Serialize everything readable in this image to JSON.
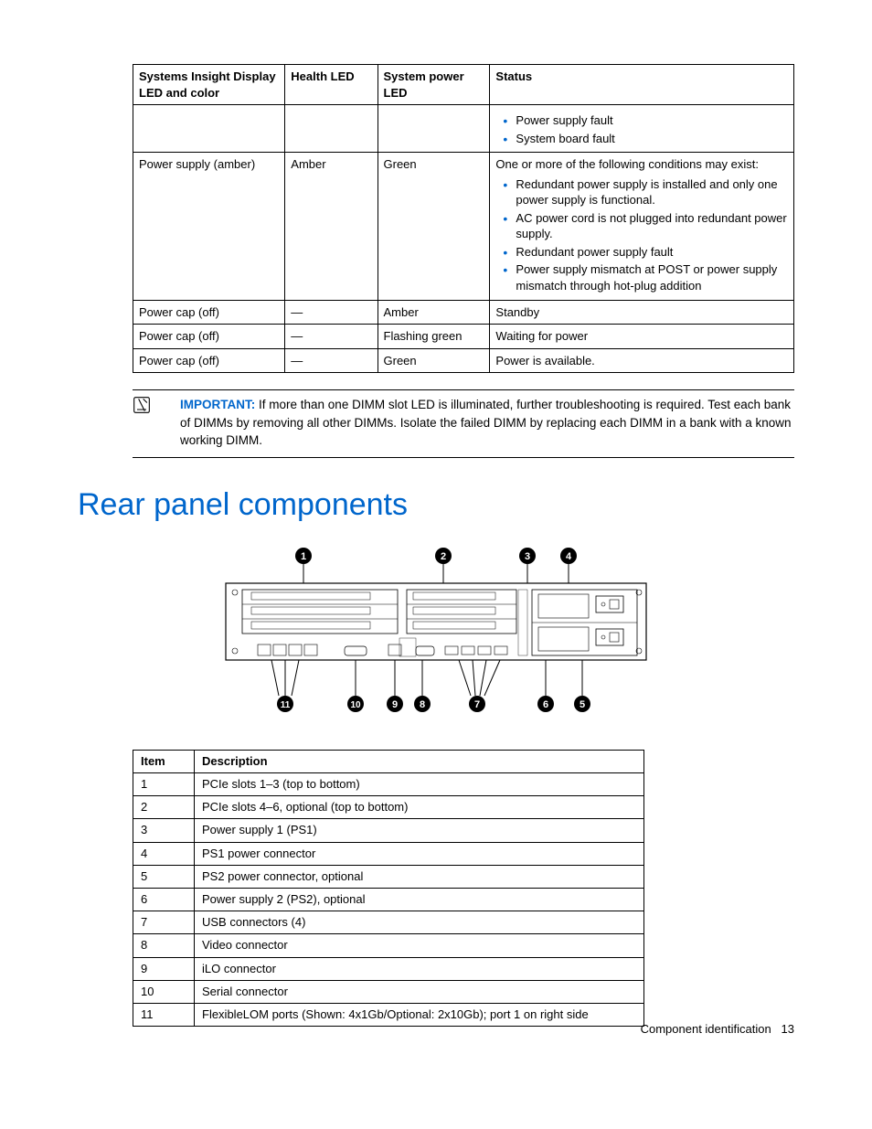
{
  "ledTable": {
    "headers": [
      "Systems Insight Display LED and color",
      "Health LED",
      "System power LED",
      "Status"
    ],
    "rows": [
      {
        "c1": "",
        "c2": "",
        "c3": "",
        "status_text": "",
        "bullets": [
          "Power supply fault",
          "System board fault"
        ]
      },
      {
        "c1": "Power supply (amber)",
        "c2": "Amber",
        "c3": "Green",
        "status_text": "One or more of the following conditions may exist:",
        "bullets": [
          "Redundant power supply is installed and only one power supply is functional.",
          "AC power cord is not plugged into redundant power supply.",
          "Redundant power supply fault",
          "Power supply mismatch at POST or power supply mismatch through hot-plug addition"
        ]
      },
      {
        "c1": "Power cap (off)",
        "c2": "—",
        "c3": "Amber",
        "status_text": "Standby",
        "bullets": []
      },
      {
        "c1": "Power cap (off)",
        "c2": "—",
        "c3": "Flashing green",
        "status_text": "Waiting for power",
        "bullets": []
      },
      {
        "c1": "Power cap (off)",
        "c2": "—",
        "c3": "Green",
        "status_text": "Power is available.",
        "bullets": []
      }
    ]
  },
  "important": {
    "label": "IMPORTANT:",
    "text": "If more than one DIMM slot LED is illuminated, further troubleshooting is required. Test each bank of DIMMs by removing all other DIMMs. Isolate the failed DIMM by replacing each DIMM in a bank with a known working DIMM."
  },
  "sectionTitle": "Rear panel components",
  "compTable": {
    "headers": [
      "Item",
      "Description"
    ],
    "rows": [
      {
        "item": "1",
        "desc": "PCIe slots 1–3 (top to bottom)"
      },
      {
        "item": "2",
        "desc": "PCIe slots 4–6, optional (top to bottom)"
      },
      {
        "item": "3",
        "desc": "Power supply 1 (PS1)"
      },
      {
        "item": "4",
        "desc": "PS1 power connector"
      },
      {
        "item": "5",
        "desc": "PS2 power connector, optional"
      },
      {
        "item": "6",
        "desc": "Power supply 2 (PS2), optional"
      },
      {
        "item": "7",
        "desc": "USB connectors (4)"
      },
      {
        "item": "8",
        "desc": "Video connector"
      },
      {
        "item": "9",
        "desc": "iLO connector"
      },
      {
        "item": "10",
        "desc": "Serial connector"
      },
      {
        "item": "11",
        "desc": "FlexibleLOM ports (Shown: 4x1Gb/Optional: 2x10Gb); port 1 on right side"
      }
    ]
  },
  "footer": {
    "section": "Component identification",
    "page": "13"
  },
  "callouts": [
    "1",
    "2",
    "3",
    "4",
    "5",
    "6",
    "7",
    "8",
    "9",
    "10",
    "11"
  ]
}
